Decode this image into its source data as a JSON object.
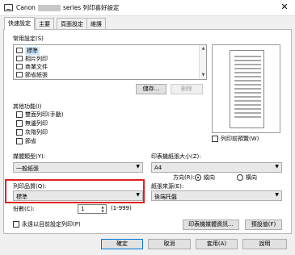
{
  "window": {
    "title_prefix": "Canon",
    "title_suffix": "series 列印喜好設定",
    "close_glyph": "✕"
  },
  "tabs": [
    "快速設定",
    "主要",
    "頁面設定",
    "維護"
  ],
  "common_settings": {
    "label": "常用設定(S)",
    "items": [
      "標準",
      "相片列印",
      "商業文件",
      "節省紙張"
    ],
    "save_label": "儲存...",
    "delete_label": "刪除"
  },
  "preview_checkbox_label": "列印前預覽(W)",
  "additional_features": {
    "label": "其他功能(I)",
    "items": [
      "雙面列印(手動)",
      "無邊列印",
      "灰階列印",
      "節省"
    ]
  },
  "media_type": {
    "label": "媒體類型(Y):",
    "value": "一般紙張"
  },
  "printer_paper_size": {
    "label": "印表機紙張大小(Z):",
    "value": "A4"
  },
  "orientation": {
    "label": "方向(R):",
    "portrait": "縱向",
    "landscape": "橫向"
  },
  "print_quality": {
    "label": "列印品質(Q):",
    "value": "標準"
  },
  "paper_source": {
    "label": "紙張來源(E):",
    "value": "後端托盤"
  },
  "copies": {
    "label": "份數(C):",
    "value": "1",
    "range": "(1-999)"
  },
  "always_print_label": "永遠以目前設定列印(P)",
  "printer_media_info_label": "印表機媒體資訊...",
  "defaults_label": "預設值(F)",
  "dialog_buttons": {
    "ok": "確定",
    "cancel": "取消",
    "apply": "套用(A)",
    "help": "說明"
  }
}
